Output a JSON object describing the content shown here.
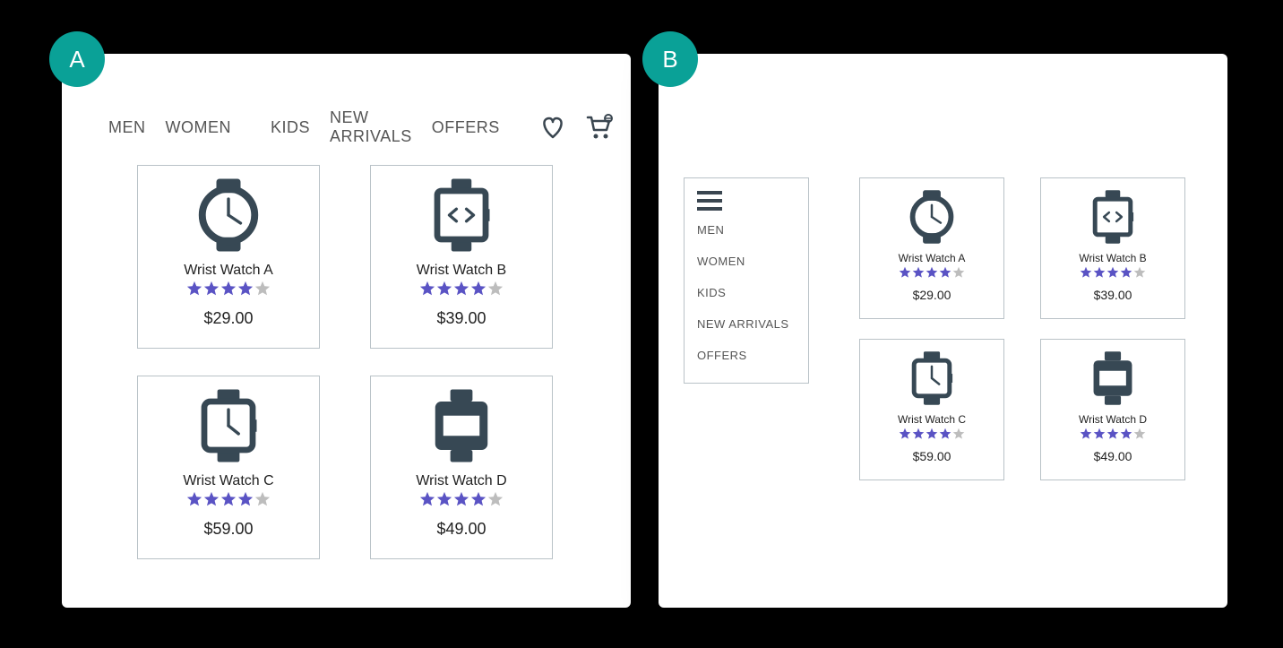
{
  "badges": {
    "a": "A",
    "b": "B"
  },
  "nav": {
    "items": [
      "MEN",
      "WOMEN",
      "KIDS",
      "NEW ARRIVALS",
      "OFFERS"
    ]
  },
  "sidebar": {
    "items": [
      "MEN",
      "WOMEN",
      "KIDS",
      "NEW ARRIVALS",
      "OFFERS"
    ]
  },
  "products": [
    {
      "name": "Wrist Watch A",
      "price": "$29.00",
      "rating": 4,
      "icon": "watch-round"
    },
    {
      "name": "Wrist Watch B",
      "price": "$39.00",
      "rating": 4,
      "icon": "watch-digital"
    },
    {
      "name": "Wrist Watch C",
      "price": "$59.00",
      "rating": 4,
      "icon": "watch-square"
    },
    {
      "name": "Wrist Watch D",
      "price": "$49.00",
      "rating": 4,
      "icon": "watch-solid"
    }
  ],
  "colors": {
    "accent": "#0aa197",
    "icon_dark": "#374854",
    "star_on": "#5a53c4",
    "star_off": "#bdbdbd",
    "border": "#b9c2c7"
  }
}
